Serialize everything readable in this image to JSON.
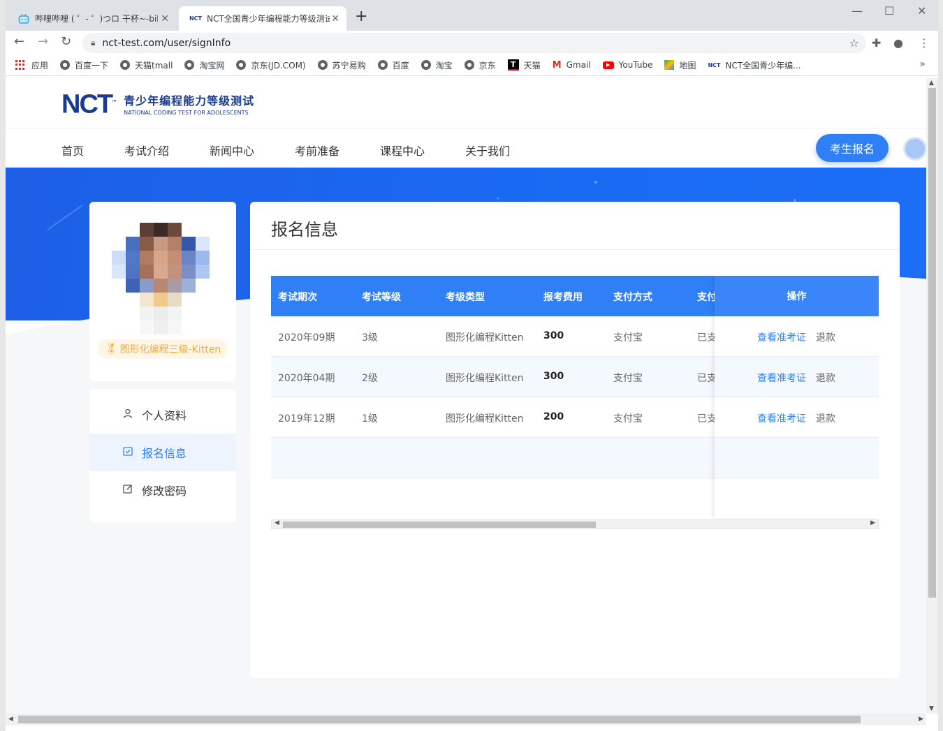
{
  "browser": {
    "tabs": [
      {
        "title": "哔哩哔哩 ( ゜- ゜)つロ 干杯~-bilil",
        "active": false
      },
      {
        "title": "NCT全国青少年编程能力等级测试",
        "active": true
      }
    ],
    "url": "nct-test.com/user/signInfo",
    "bookmarks": [
      {
        "label": "应用",
        "icon": "apps-icon"
      },
      {
        "label": "百度一下",
        "icon": "globe-icon"
      },
      {
        "label": "天猫tmall",
        "icon": "globe-icon"
      },
      {
        "label": "淘宝网",
        "icon": "globe-icon"
      },
      {
        "label": "京东(JD.COM)",
        "icon": "globe-icon"
      },
      {
        "label": "苏宁易购",
        "icon": "globe-icon"
      },
      {
        "label": "百度",
        "icon": "globe-icon"
      },
      {
        "label": "淘宝",
        "icon": "globe-icon"
      },
      {
        "label": "京东",
        "icon": "globe-icon"
      },
      {
        "label": "天猫",
        "icon": "tmall-icon"
      },
      {
        "label": "Gmail",
        "icon": "gmail-icon"
      },
      {
        "label": "YouTube",
        "icon": "youtube-icon"
      },
      {
        "label": "地图",
        "icon": "maps-icon"
      },
      {
        "label": "NCT全国青少年编...",
        "icon": "nct-icon"
      }
    ]
  },
  "site": {
    "logo_mark": "NCT",
    "logo_tm": "™",
    "logo_cn": "青少年编程能力等级测试",
    "logo_en": "NATIONAL CODING TEST FOR ADOLESCENTS",
    "nav": [
      "首页",
      "考试介绍",
      "新闻中心",
      "考前准备",
      "课程中心",
      "关于我们"
    ],
    "signup_label": "考生报名"
  },
  "profile": {
    "level_badge": "图形化编程三级-Kitten"
  },
  "side_menu": [
    {
      "label": "个人资料",
      "icon": "user-icon",
      "active": false
    },
    {
      "label": "报名信息",
      "icon": "checkbox-icon",
      "active": true
    },
    {
      "label": "修改密码",
      "icon": "edit-icon",
      "active": false
    }
  ],
  "registration": {
    "title": "报名信息",
    "columns": [
      "考试期次",
      "考试等级",
      "考级类型",
      "报考费用",
      "支付方式",
      "支付",
      "操作"
    ],
    "rows": [
      {
        "period": "2020年09期",
        "level": "3级",
        "type": "图形化编程Kitten",
        "fee": "300",
        "payment": "支付宝",
        "status": "已支"
      },
      {
        "period": "2020年04期",
        "level": "2级",
        "type": "图形化编程Kitten",
        "fee": "300",
        "payment": "支付宝",
        "status": "已支"
      },
      {
        "period": "2019年12期",
        "level": "1级",
        "type": "图形化编程Kitten",
        "fee": "200",
        "payment": "支付宝",
        "status": "已支"
      }
    ],
    "action_view": "查看准考证",
    "action_refund": "退款"
  },
  "colors": {
    "primary": "#2f7ff6",
    "banner": "#1a6af3",
    "badge_text": "#f2a93b",
    "logo_navy": "#1b3b8c"
  }
}
